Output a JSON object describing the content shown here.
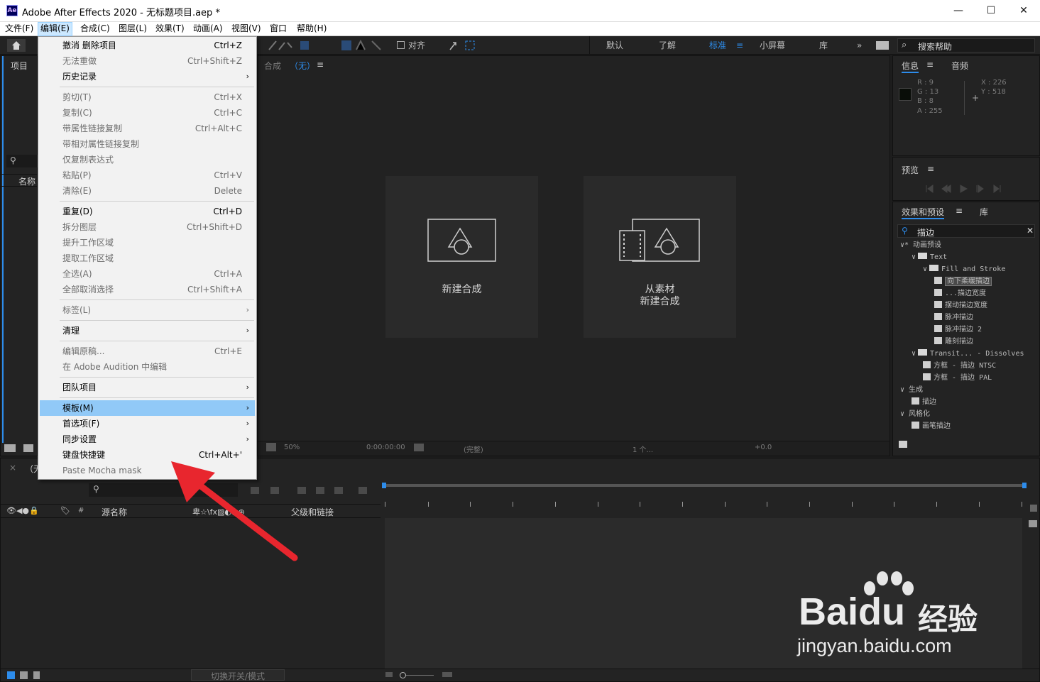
{
  "window": {
    "app_logo": "Ae",
    "title": "Adobe After Effects 2020 - 无标题项目.aep *",
    "minimize": "—",
    "maximize": "☐",
    "close": "✕"
  },
  "menubar": [
    "文件(F)",
    "编辑(E)",
    "合成(C)",
    "图层(L)",
    "效果(T)",
    "动画(A)",
    "视图(V)",
    "窗口",
    "帮助(H)"
  ],
  "toolbar": {
    "align": "对齐",
    "workspaces": [
      "默认",
      "了解",
      "标准",
      "小屏幕",
      "库"
    ],
    "active_workspace": "标准",
    "more": "»",
    "search_help": "搜索帮助"
  },
  "project_panel": {
    "tab": "项目",
    "col_name": "名称"
  },
  "comp_panel": {
    "title": "合成",
    "comp_name": "（无）",
    "menu_icon": "≡",
    "zoom": "50%",
    "timecode": "0:00:00:00",
    "quality": "(完整)",
    "views": "1 个...",
    "exposure": "+0.0"
  },
  "cards": [
    {
      "label1": "新建合成",
      "label2": ""
    },
    {
      "label1": "从素材",
      "label2": "新建合成"
    }
  ],
  "info_panel": {
    "tab": "信息",
    "tab2": "音频",
    "r": "R : 9",
    "g": "G : 13",
    "b": "B : 8",
    "a": "A : 255",
    "x": "X : 226",
    "y": "Y : 518"
  },
  "preview_panel": {
    "tab": "预览"
  },
  "effects_panel": {
    "tab": "效果和预设",
    "tab2": "库",
    "search": "描边",
    "tree": [
      {
        "label": "∨* 动画预设",
        "indent": 0,
        "type": "none",
        "sel": false
      },
      {
        "label": "Text",
        "indent": 1,
        "type": "folder",
        "sel": false
      },
      {
        "label": "Fill and Stroke",
        "indent": 2,
        "type": "folder",
        "sel": false
      },
      {
        "label": "向下柔缓描边",
        "indent": 3,
        "type": "fx",
        "sel": true
      },
      {
        "label": "...描边宽度",
        "indent": 3,
        "type": "fx",
        "sel": false
      },
      {
        "label": "摆动描边宽度",
        "indent": 3,
        "type": "fx",
        "sel": false
      },
      {
        "label": "脉冲描边",
        "indent": 3,
        "type": "fx",
        "sel": false
      },
      {
        "label": "脉冲描边 2",
        "indent": 3,
        "type": "fx",
        "sel": false
      },
      {
        "label": "雕刻描边",
        "indent": 3,
        "type": "fx",
        "sel": false
      },
      {
        "label": "Transit... - Dissolves",
        "indent": 1,
        "type": "folder",
        "sel": false
      },
      {
        "label": "方框 - 描边 NTSC",
        "indent": 2,
        "type": "fx",
        "sel": false
      },
      {
        "label": "方框 - 描边 PAL",
        "indent": 2,
        "type": "fx",
        "sel": false
      },
      {
        "label": "∨ 生成",
        "indent": 0,
        "type": "none",
        "sel": false
      },
      {
        "label": "描边",
        "indent": 1,
        "type": "fx",
        "sel": false
      },
      {
        "label": "∨ 风格化",
        "indent": 0,
        "type": "none",
        "sel": false
      },
      {
        "label": "画笔描边",
        "indent": 1,
        "type": "fx",
        "sel": false
      }
    ]
  },
  "timeline": {
    "tab": "（无",
    "col_source": "源名称",
    "col_parent": "父级和链接",
    "toggle": "切换开关/模式"
  },
  "edit_menu": [
    {
      "l": "撤消 删除项目",
      "s": "Ctrl+Z",
      "arrow": false,
      "dis": false,
      "hl": false
    },
    {
      "l": "无法重做",
      "s": "Ctrl+Shift+Z",
      "arrow": false,
      "dis": true,
      "hl": false
    },
    {
      "l": "历史记录",
      "s": "",
      "arrow": true,
      "dis": false,
      "hl": false
    },
    {
      "sep": true
    },
    {
      "l": "剪切(T)",
      "s": "Ctrl+X",
      "arrow": false,
      "dis": true,
      "hl": false
    },
    {
      "l": "复制(C)",
      "s": "Ctrl+C",
      "arrow": false,
      "dis": true,
      "hl": false
    },
    {
      "l": "带属性链接复制",
      "s": "Ctrl+Alt+C",
      "arrow": false,
      "dis": true,
      "hl": false
    },
    {
      "l": "带相对属性链接复制",
      "s": "",
      "arrow": false,
      "dis": true,
      "hl": false
    },
    {
      "l": "仅复制表达式",
      "s": "",
      "arrow": false,
      "dis": true,
      "hl": false
    },
    {
      "l": "粘贴(P)",
      "s": "Ctrl+V",
      "arrow": false,
      "dis": true,
      "hl": false
    },
    {
      "l": "清除(E)",
      "s": "Delete",
      "arrow": false,
      "dis": true,
      "hl": false
    },
    {
      "sep": true
    },
    {
      "l": "重复(D)",
      "s": "Ctrl+D",
      "arrow": false,
      "dis": false,
      "hl": false
    },
    {
      "l": "拆分图层",
      "s": "Ctrl+Shift+D",
      "arrow": false,
      "dis": true,
      "hl": false
    },
    {
      "l": "提升工作区域",
      "s": "",
      "arrow": false,
      "dis": true,
      "hl": false
    },
    {
      "l": "提取工作区域",
      "s": "",
      "arrow": false,
      "dis": true,
      "hl": false
    },
    {
      "l": "全选(A)",
      "s": "Ctrl+A",
      "arrow": false,
      "dis": true,
      "hl": false
    },
    {
      "l": "全部取消选择",
      "s": "Ctrl+Shift+A",
      "arrow": false,
      "dis": true,
      "hl": false
    },
    {
      "sep": true
    },
    {
      "l": "标签(L)",
      "s": "",
      "arrow": true,
      "dis": true,
      "hl": false
    },
    {
      "sep": true
    },
    {
      "l": "清理",
      "s": "",
      "arrow": true,
      "dis": false,
      "hl": false
    },
    {
      "sep": true
    },
    {
      "l": "编辑原稿...",
      "s": "Ctrl+E",
      "arrow": false,
      "dis": true,
      "hl": false
    },
    {
      "l": "在 Adobe Audition 中编辑",
      "s": "",
      "arrow": false,
      "dis": true,
      "hl": false
    },
    {
      "sep": true
    },
    {
      "l": "团队项目",
      "s": "",
      "arrow": true,
      "dis": false,
      "hl": false
    },
    {
      "sep": true
    },
    {
      "l": "模板(M)",
      "s": "",
      "arrow": true,
      "dis": false,
      "hl": true
    },
    {
      "l": "首选项(F)",
      "s": "",
      "arrow": true,
      "dis": false,
      "hl": false
    },
    {
      "l": "同步设置",
      "s": "",
      "arrow": true,
      "dis": false,
      "hl": false
    },
    {
      "l": "键盘快捷键",
      "s": "Ctrl+Alt+'",
      "arrow": false,
      "dis": false,
      "hl": false
    },
    {
      "l": "Paste Mocha mask",
      "s": "",
      "arrow": false,
      "dis": true,
      "hl": false
    }
  ],
  "watermark": {
    "brand1": "Bai",
    "brand2": "du",
    "brand3": "经验",
    "url": "jingyan.baidu.com"
  },
  "colors": {
    "accent": "#2d8ceb",
    "menu_highlight": "#91c9f7",
    "arrow": "#e8262e"
  }
}
